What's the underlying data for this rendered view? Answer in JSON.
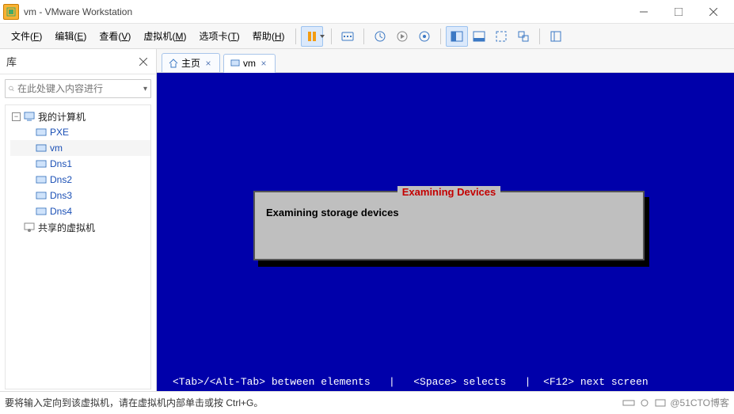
{
  "title": "vm - VMware Workstation",
  "menus": {
    "file": {
      "label": "文件",
      "key": "F"
    },
    "edit": {
      "label": "编辑",
      "key": "E"
    },
    "view": {
      "label": "查看",
      "key": "V"
    },
    "vm": {
      "label": "虚拟机",
      "key": "M"
    },
    "tabs": {
      "label": "选项卡",
      "key": "T"
    },
    "help": {
      "label": "帮助",
      "key": "H"
    }
  },
  "sidebar": {
    "title": "库",
    "search_placeholder": "在此处键入内容进行",
    "root": "我的计算机",
    "items": [
      "PXE",
      "vm",
      "Dns1",
      "Dns2",
      "Dns3",
      "Dns4"
    ],
    "selected": "vm",
    "shared": "共享的虚拟机"
  },
  "tabs": {
    "home": "主页",
    "vm": "vm"
  },
  "console": {
    "dialog_title": "Examining Devices",
    "dialog_body": "Examining storage devices",
    "help": "<Tab>/<Alt-Tab> between elements   |   <Space> selects   |  <F12> next screen"
  },
  "status": {
    "hint": "要将输入定向到该虚拟机，请在虚拟机内部单击或按 Ctrl+G。",
    "badge": "@51CTO博客"
  }
}
